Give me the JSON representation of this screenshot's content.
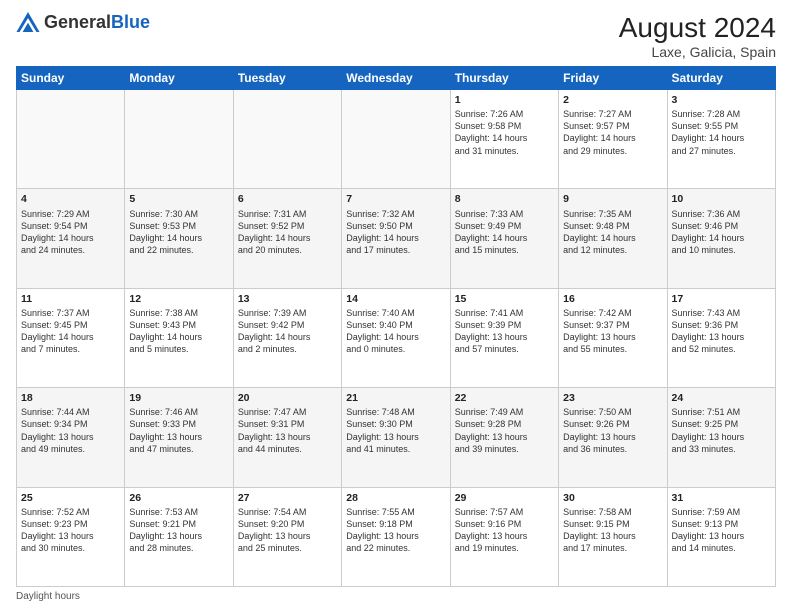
{
  "header": {
    "logo_general": "General",
    "logo_blue": "Blue",
    "month_year": "August 2024",
    "location": "Laxe, Galicia, Spain"
  },
  "days_of_week": [
    "Sunday",
    "Monday",
    "Tuesday",
    "Wednesday",
    "Thursday",
    "Friday",
    "Saturday"
  ],
  "footer": {
    "daylight_hours": "Daylight hours"
  },
  "weeks": [
    [
      {
        "day": "",
        "info": ""
      },
      {
        "day": "",
        "info": ""
      },
      {
        "day": "",
        "info": ""
      },
      {
        "day": "",
        "info": ""
      },
      {
        "day": "1",
        "info": "Sunrise: 7:26 AM\nSunset: 9:58 PM\nDaylight: 14 hours\nand 31 minutes."
      },
      {
        "day": "2",
        "info": "Sunrise: 7:27 AM\nSunset: 9:57 PM\nDaylight: 14 hours\nand 29 minutes."
      },
      {
        "day": "3",
        "info": "Sunrise: 7:28 AM\nSunset: 9:55 PM\nDaylight: 14 hours\nand 27 minutes."
      }
    ],
    [
      {
        "day": "4",
        "info": "Sunrise: 7:29 AM\nSunset: 9:54 PM\nDaylight: 14 hours\nand 24 minutes."
      },
      {
        "day": "5",
        "info": "Sunrise: 7:30 AM\nSunset: 9:53 PM\nDaylight: 14 hours\nand 22 minutes."
      },
      {
        "day": "6",
        "info": "Sunrise: 7:31 AM\nSunset: 9:52 PM\nDaylight: 14 hours\nand 20 minutes."
      },
      {
        "day": "7",
        "info": "Sunrise: 7:32 AM\nSunset: 9:50 PM\nDaylight: 14 hours\nand 17 minutes."
      },
      {
        "day": "8",
        "info": "Sunrise: 7:33 AM\nSunset: 9:49 PM\nDaylight: 14 hours\nand 15 minutes."
      },
      {
        "day": "9",
        "info": "Sunrise: 7:35 AM\nSunset: 9:48 PM\nDaylight: 14 hours\nand 12 minutes."
      },
      {
        "day": "10",
        "info": "Sunrise: 7:36 AM\nSunset: 9:46 PM\nDaylight: 14 hours\nand 10 minutes."
      }
    ],
    [
      {
        "day": "11",
        "info": "Sunrise: 7:37 AM\nSunset: 9:45 PM\nDaylight: 14 hours\nand 7 minutes."
      },
      {
        "day": "12",
        "info": "Sunrise: 7:38 AM\nSunset: 9:43 PM\nDaylight: 14 hours\nand 5 minutes."
      },
      {
        "day": "13",
        "info": "Sunrise: 7:39 AM\nSunset: 9:42 PM\nDaylight: 14 hours\nand 2 minutes."
      },
      {
        "day": "14",
        "info": "Sunrise: 7:40 AM\nSunset: 9:40 PM\nDaylight: 14 hours\nand 0 minutes."
      },
      {
        "day": "15",
        "info": "Sunrise: 7:41 AM\nSunset: 9:39 PM\nDaylight: 13 hours\nand 57 minutes."
      },
      {
        "day": "16",
        "info": "Sunrise: 7:42 AM\nSunset: 9:37 PM\nDaylight: 13 hours\nand 55 minutes."
      },
      {
        "day": "17",
        "info": "Sunrise: 7:43 AM\nSunset: 9:36 PM\nDaylight: 13 hours\nand 52 minutes."
      }
    ],
    [
      {
        "day": "18",
        "info": "Sunrise: 7:44 AM\nSunset: 9:34 PM\nDaylight: 13 hours\nand 49 minutes."
      },
      {
        "day": "19",
        "info": "Sunrise: 7:46 AM\nSunset: 9:33 PM\nDaylight: 13 hours\nand 47 minutes."
      },
      {
        "day": "20",
        "info": "Sunrise: 7:47 AM\nSunset: 9:31 PM\nDaylight: 13 hours\nand 44 minutes."
      },
      {
        "day": "21",
        "info": "Sunrise: 7:48 AM\nSunset: 9:30 PM\nDaylight: 13 hours\nand 41 minutes."
      },
      {
        "day": "22",
        "info": "Sunrise: 7:49 AM\nSunset: 9:28 PM\nDaylight: 13 hours\nand 39 minutes."
      },
      {
        "day": "23",
        "info": "Sunrise: 7:50 AM\nSunset: 9:26 PM\nDaylight: 13 hours\nand 36 minutes."
      },
      {
        "day": "24",
        "info": "Sunrise: 7:51 AM\nSunset: 9:25 PM\nDaylight: 13 hours\nand 33 minutes."
      }
    ],
    [
      {
        "day": "25",
        "info": "Sunrise: 7:52 AM\nSunset: 9:23 PM\nDaylight: 13 hours\nand 30 minutes."
      },
      {
        "day": "26",
        "info": "Sunrise: 7:53 AM\nSunset: 9:21 PM\nDaylight: 13 hours\nand 28 minutes."
      },
      {
        "day": "27",
        "info": "Sunrise: 7:54 AM\nSunset: 9:20 PM\nDaylight: 13 hours\nand 25 minutes."
      },
      {
        "day": "28",
        "info": "Sunrise: 7:55 AM\nSunset: 9:18 PM\nDaylight: 13 hours\nand 22 minutes."
      },
      {
        "day": "29",
        "info": "Sunrise: 7:57 AM\nSunset: 9:16 PM\nDaylight: 13 hours\nand 19 minutes."
      },
      {
        "day": "30",
        "info": "Sunrise: 7:58 AM\nSunset: 9:15 PM\nDaylight: 13 hours\nand 17 minutes."
      },
      {
        "day": "31",
        "info": "Sunrise: 7:59 AM\nSunset: 9:13 PM\nDaylight: 13 hours\nand 14 minutes."
      }
    ]
  ]
}
